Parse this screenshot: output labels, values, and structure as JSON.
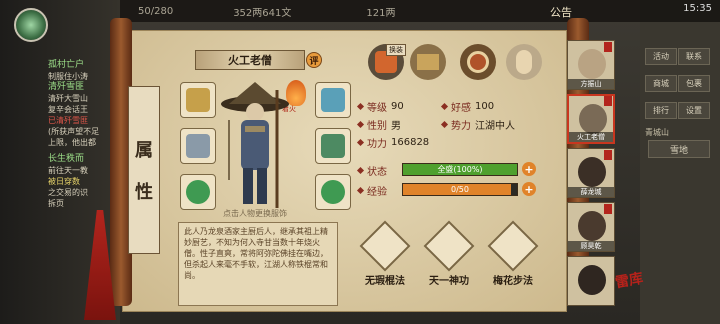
{
  "topbar": {
    "resource1": "50/280",
    "resource2": "352两641文",
    "resource3": "121两",
    "announcement": "公告",
    "time": "15:35"
  },
  "quest": {
    "q1_title": "孤村亡户",
    "q1_text": "制服住小涛",
    "q2_title": "清歼雪匪",
    "q2_text_a": "清歼大雪山",
    "q2_text_b": "复辛会话王",
    "q2_text_c": "已清歼雪匪",
    "q2_text_d": "(所获声望不足",
    "q2_text_e": "上限，他出都",
    "q3_title": "长生秩而",
    "q3_text_a": "前往天一教",
    "q3_text_b": "被日穿数",
    "q3_text_c": "之交易的识",
    "q3_text_d": "拆页"
  },
  "right_menu": {
    "btn1": "活动",
    "btn2": "联系",
    "btn3": "商城",
    "btn4": "包裹",
    "btn5": "排行",
    "btn6": "设置",
    "location": "青城山",
    "weather": "雪地"
  },
  "side_tab": {
    "char1": "属",
    "char2": "性"
  },
  "character": {
    "name": "火工老僧",
    "eval_tag": "评",
    "flame_label": "着火",
    "hint": "点击人物更换服饰",
    "description": "此人乃龙泉酒家主厨后人，继承其祖上精妙厨艺，不知为何入寺甘当数十年烧火僧。性子直爽，常将阿弥陀佛挂在嘴边，但杀起人来毫不手软，江湖人称铁棍常和尚。"
  },
  "stats": {
    "level_label": "等级",
    "level_value": "90",
    "favor_label": "好感",
    "favor_value": "100",
    "gender_label": "性别",
    "gender_value": "男",
    "faction_label": "势力",
    "faction_value": "江湖中人",
    "power_label": "功力",
    "power_value": "166828",
    "status_label": "状态",
    "status_text": "全盛(100%)",
    "status_ratio": 1.0,
    "exp_label": "经验",
    "exp_text": "0/50",
    "exp_ratio": 0.95
  },
  "top_icon_badge": "换装",
  "skills": [
    {
      "level": "+",
      "name": "无瑕棍法"
    },
    {
      "level": "九",
      "name": "天一神功"
    },
    {
      "level": "+",
      "name": "梅花步法"
    }
  ],
  "party": [
    {
      "name": "方振山"
    },
    {
      "name": "火工老僧"
    },
    {
      "name": "薛龙城"
    },
    {
      "name": "顾昊乾"
    },
    {
      "name": ""
    }
  ],
  "seal_text": "雷库",
  "colors": {
    "status_fill": "#4fa02e",
    "exp_fill": "#e0832a",
    "paper": "#d9c9a3",
    "accent_red": "#b3251d"
  }
}
